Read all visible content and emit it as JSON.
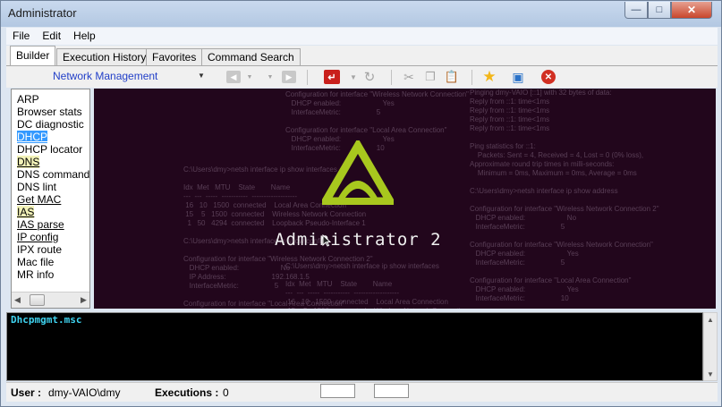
{
  "window": {
    "title": "Administrator",
    "min_icon": "minimize-icon",
    "max_icon": "maximize-icon",
    "close_icon": "close-icon"
  },
  "menu": [
    "File",
    "Edit",
    "Help"
  ],
  "tabs": [
    {
      "label": "Builder",
      "active": true
    },
    {
      "label": "Execution History",
      "active": false
    },
    {
      "label": "Favorites",
      "active": false
    },
    {
      "label": "Command Search",
      "active": false
    }
  ],
  "toolbar": {
    "combo_value": "Network Management",
    "icons": [
      "back-icon",
      "dropdown-icon",
      "dropdown-icon",
      "forward-icon",
      "run-icon",
      "refresh-icon",
      "cut-icon",
      "copy-icon",
      "paste-icon",
      "favorite-star-icon",
      "monitor-icon",
      "stop-icon"
    ],
    "colors": {
      "combo_text": "#2340c8",
      "run": "#c9201c",
      "star": "#f2b61a",
      "stop": "#d12f22"
    }
  },
  "commands": [
    {
      "label": "ARP",
      "style": "plain"
    },
    {
      "label": "Browser stats",
      "style": "plain"
    },
    {
      "label": "DC diagnostic",
      "style": "plain"
    },
    {
      "label": "DHCP",
      "style": "selected"
    },
    {
      "label": "DHCP locator",
      "style": "plain"
    },
    {
      "label": "DNS",
      "style": "highlight"
    },
    {
      "label": "DNS command",
      "style": "plain"
    },
    {
      "label": "DNS lint",
      "style": "plain"
    },
    {
      "label": "Get MAC",
      "style": "underline"
    },
    {
      "label": "IAS",
      "style": "highlight"
    },
    {
      "label": "IAS parse",
      "style": "underline"
    },
    {
      "label": "IP config",
      "style": "underline"
    },
    {
      "label": "IPX route",
      "style": "plain"
    },
    {
      "label": "Mac file",
      "style": "plain"
    },
    {
      "label": "MR info",
      "style": "plain"
    }
  ],
  "splash": {
    "title": "Administrator 2",
    "logo_color": "#a8c81e",
    "background": "#22061c"
  },
  "output": {
    "text": "Dhcpmgmt.msc",
    "color": "#3fd3f0"
  },
  "status": {
    "user_label": "User :",
    "user_value": "dmy-VAIO\\dmy",
    "executions_label": "Executions :",
    "executions_value": "0"
  }
}
